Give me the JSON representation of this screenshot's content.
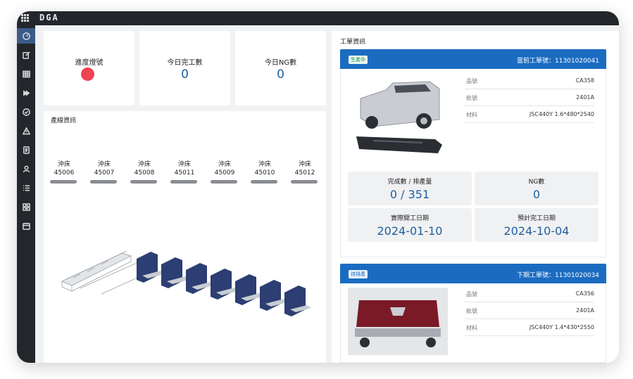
{
  "brand": {
    "logo_text": "DGA"
  },
  "sidebar": {
    "icons": [
      "dashboard-icon",
      "edit-icon",
      "table-icon",
      "fast-forward-icon",
      "check-circle-icon",
      "warning-icon",
      "document-icon",
      "user-icon",
      "list-icon",
      "apps-icon",
      "calendar-icon"
    ]
  },
  "stats": {
    "progress_light": {
      "label": "進度燈號",
      "color": "#ef4350"
    },
    "completed_today": {
      "label": "今日完工數",
      "value": "0"
    },
    "ng_today": {
      "label": "今日NG數",
      "value": "0"
    }
  },
  "line_info": {
    "title": "產線資訊",
    "machines": [
      {
        "type": "沖床",
        "id": "45006"
      },
      {
        "type": "沖床",
        "id": "45007"
      },
      {
        "type": "沖床",
        "id": "45008"
      },
      {
        "type": "沖床",
        "id": "45011"
      },
      {
        "type": "沖床",
        "id": "45009"
      },
      {
        "type": "沖床",
        "id": "45010"
      },
      {
        "type": "沖床",
        "id": "45012"
      }
    ]
  },
  "work_orders": {
    "title": "工單資訊",
    "current": {
      "status": "生產中",
      "number_label": "當前工單號：11301020041",
      "specs": [
        {
          "key": "品號",
          "value": "CA358"
        },
        {
          "key": "批號",
          "value": "2401A"
        },
        {
          "key": "材料",
          "value": "JSC440Y 1.6*480*2540"
        }
      ],
      "kpis": {
        "done_label": "完成數 / 排產量",
        "done_value": "0 / 351",
        "ng_label": "NG數",
        "ng_value": "0",
        "start_label": "實際開工日期",
        "start_value": "2024-01-10",
        "end_label": "預計完工日期",
        "end_value": "2024-10-04"
      }
    },
    "next": {
      "status": "待排產",
      "number_label": "下期工單號：11301020034",
      "specs": [
        {
          "key": "品號",
          "value": "CA356"
        },
        {
          "key": "批號",
          "value": "2401A"
        },
        {
          "key": "材料",
          "value": "JSC440Y 1.4*430*2550"
        }
      ]
    }
  }
}
